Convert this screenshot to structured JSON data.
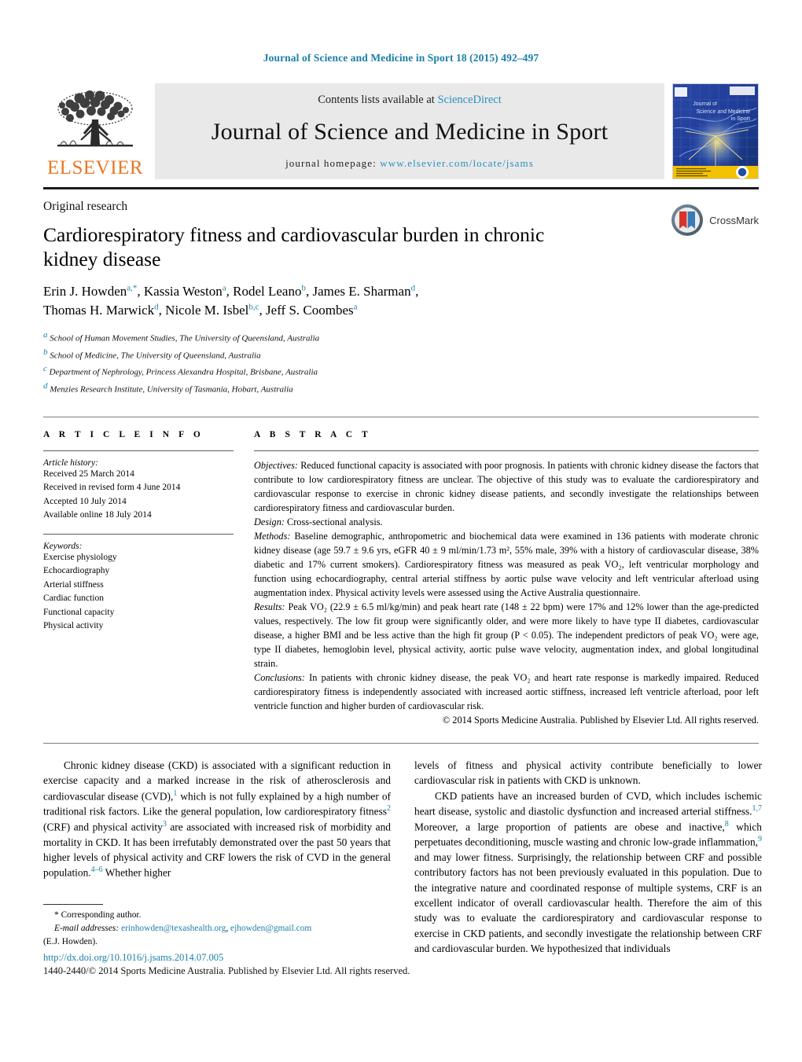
{
  "running_head": "Journal of Science and Medicine in Sport 18 (2015) 492–497",
  "masthead": {
    "publisher": "ELSEVIER",
    "contents_prefix": "Contents lists available at ",
    "contents_link": "ScienceDirect",
    "journal_title": "Journal of Science and Medicine in Sport",
    "homepage_prefix": "journal homepage: ",
    "homepage_url": "www.elsevier.com/locate/jsams",
    "cover_title_line1": "Journal of",
    "cover_title_line2": "Science and Medicine",
    "cover_title_line3": "in Sport"
  },
  "article": {
    "kicker": "Original research",
    "title": "Cardiorespiratory fitness and cardiovascular burden in chronic kidney disease",
    "crossmark_label": "CrossMark",
    "authors": [
      {
        "name": "Erin J. Howden",
        "sup": "a,",
        "star": "*",
        "sep": ", "
      },
      {
        "name": "Kassia Weston",
        "sup": "a",
        "sep": ", "
      },
      {
        "name": "Rodel Leano",
        "sup": "b",
        "sep": ", "
      },
      {
        "name": "James E. Sharman",
        "sup": "d",
        "sep": ","
      },
      {
        "name": "Thomas H. Marwick",
        "sup": "d",
        "sep": ", "
      },
      {
        "name": "Nicole M. Isbel",
        "sup": "b,c",
        "sep": ", "
      },
      {
        "name": "Jeff S. Coombes",
        "sup": "a",
        "sep": ""
      }
    ],
    "affiliations": [
      {
        "marker": "a",
        "text": "School of Human Movement Studies, The University of Queensland, Australia"
      },
      {
        "marker": "b",
        "text": "School of Medicine, The University of Queensland, Australia"
      },
      {
        "marker": "c",
        "text": "Department of Nephrology, Princess Alexandra Hospital, Brisbane, Australia"
      },
      {
        "marker": "d",
        "text": "Menzies Research Institute, University of Tasmania, Hobart, Australia"
      }
    ]
  },
  "article_info": {
    "heading": "A R T I C L E   I N F O",
    "history_label": "Article history:",
    "history": [
      "Received 25 March 2014",
      "Received in revised form 4 June 2014",
      "Accepted 10 July 2014",
      "Available online 18 July 2014"
    ],
    "keywords_label": "Keywords:",
    "keywords": [
      "Exercise physiology",
      "Echocardiography",
      "Arterial stiffness",
      "Cardiac function",
      "Functional capacity",
      "Physical activity"
    ]
  },
  "abstract": {
    "heading": "A B S T R A C T",
    "objectives_label": "Objectives:",
    "objectives_text": " Reduced functional capacity is associated with poor prognosis. In patients with chronic kidney disease the factors that contribute to low cardiorespiratory fitness are unclear. The objective of this study was to evaluate the cardiorespiratory and cardiovascular response to exercise in chronic kidney disease patients, and secondly investigate the relationships between cardiorespiratory fitness and cardiovascular burden.",
    "design_label": "Design:",
    "design_text": " Cross-sectional analysis.",
    "methods_label": "Methods:",
    "methods_text": " Baseline demographic, anthropometric and biochemical data were examined in 136 patients with moderate chronic kidney disease (age 59.7 ± 9.6 yrs, eGFR 40 ± 9 ml/min/1.73 m², 55% male, 39% with a history of cardiovascular disease, 38% diabetic and 17% current smokers). Cardiorespiratory fitness was measured as peak VO₂, left ventricular morphology and function using echocardiography, central arterial stiffness by aortic pulse wave velocity and left ventricular afterload using augmentation index. Physical activity levels were assessed using the Active Australia questionnaire.",
    "results_label": "Results:",
    "results_text": " Peak VO₂ (22.9 ± 6.5 ml/kg/min) and peak heart rate (148 ± 22 bpm) were 17% and 12% lower than the age-predicted values, respectively. The low fit group were significantly older, and were more likely to have type II diabetes, cardiovascular disease, a higher BMI and be less active than the high fit group (P < 0.05). The independent predictors of peak VO₂ were age, type II diabetes, hemoglobin level, physical activity, aortic pulse wave velocity, augmentation index, and global longitudinal strain.",
    "conclusions_label": "Conclusions:",
    "conclusions_text": " In patients with chronic kidney disease, the peak VO₂ and heart rate response is markedly impaired. Reduced cardiorespiratory fitness is independently associated with increased aortic stiffness, increased left ventricle afterload, poor left ventricle function and higher burden of cardiovascular risk.",
    "copyright": "© 2014 Sports Medicine Australia. Published by Elsevier Ltd. All rights reserved."
  },
  "body": {
    "left_p1_a": "Chronic kidney disease (CKD) is associated with a significant reduction in exercise capacity and a marked increase in the risk of atherosclerosis and cardiovascular disease (CVD),",
    "left_p1_ref1": "1",
    "left_p1_b": " which is not fully explained by a high number of traditional risk factors. Like the general population, low cardiorespiratory fitness",
    "left_p1_ref2": "2",
    "left_p1_c": " (CRF) and physical activity",
    "left_p1_ref3": "3",
    "left_p1_d": " are associated with increased risk of morbidity and mortality in CKD. It has been irrefutably demonstrated over the past 50 years that higher levels of physical activity and CRF lowers the risk of CVD in the general population.",
    "left_p1_ref4": "4–6",
    "left_p1_e": " Whether higher",
    "right_p1_a": "levels of fitness and physical activity contribute beneficially to lower cardiovascular risk in patients with CKD is unknown.",
    "right_p2_a": "CKD patients have an increased burden of CVD, which includes ischemic heart disease, systolic and diastolic dysfunction and increased arterial stiffness.",
    "right_p2_ref1": "1,7",
    "right_p2_b": " Moreover, a large proportion of patients are obese and inactive,",
    "right_p2_ref2": "8",
    "right_p2_c": " which perpetuates deconditioning, muscle wasting and chronic low-grade inflammation,",
    "right_p2_ref3": "9",
    "right_p2_d": " and may lower fitness. Surprisingly, the relationship between CRF and possible contributory factors has not been previously evaluated in this population. Due to the integrative nature and coordinated response of multiple systems, CRF is an excellent indicator of overall cardiovascular health. Therefore the aim of this study was to evaluate the cardiorespiratory and cardiovascular response to exercise in CKD patients, and secondly investigate the relationship between CRF and cardiovascular burden. We hypothesized that individuals"
  },
  "footer": {
    "corresponding_marker": "*",
    "corresponding_label": "Corresponding author.",
    "email_label": "E-mail addresses:",
    "email1": "erinhowden@texashealth.org",
    "email_sep": ", ",
    "email2": "ejhowden@gmail.com",
    "email_attrib": "(E.J. Howden).",
    "doi": "http://dx.doi.org/10.1016/j.jsams.2014.07.005",
    "issn_line": "1440-2440/© 2014 Sports Medicine Australia. Published by Elsevier Ltd. All rights reserved."
  },
  "colors": {
    "link_blue": "#1a7fa8",
    "sd_blue": "#2a8fc4",
    "elsevier_orange": "#e87722",
    "masthead_gray": "#e9e9e9"
  }
}
